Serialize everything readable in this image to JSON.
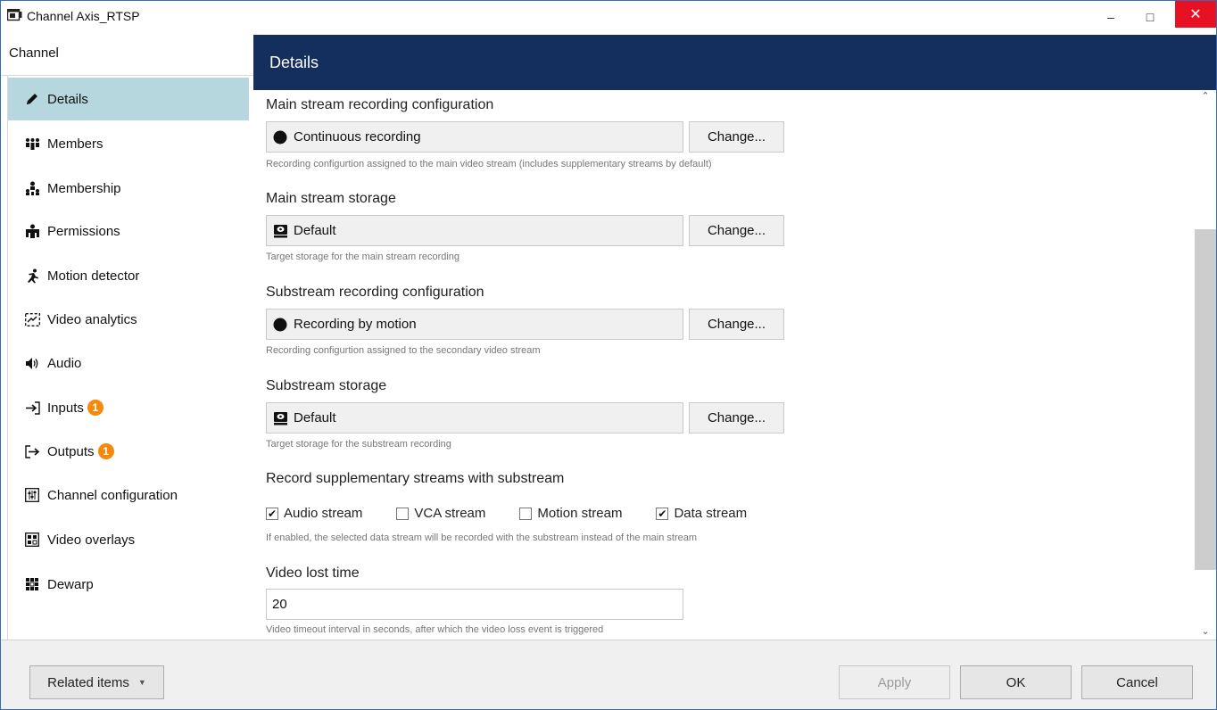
{
  "window": {
    "title": "Channel Axis_RTSP",
    "controls": {
      "minimize": "–",
      "maximize": "□",
      "close": "✕"
    }
  },
  "sidebar": {
    "header": "Channel",
    "items": [
      {
        "label": "Details",
        "icon": "pencil-icon",
        "active": true,
        "badge": null
      },
      {
        "label": "Members",
        "icon": "members-icon",
        "active": false,
        "badge": null
      },
      {
        "label": "Membership",
        "icon": "membership-icon",
        "active": false,
        "badge": null
      },
      {
        "label": "Permissions",
        "icon": "permissions-icon",
        "active": false,
        "badge": null
      },
      {
        "label": "Motion detector",
        "icon": "running-person-icon",
        "active": false,
        "badge": null
      },
      {
        "label": "Video analytics",
        "icon": "analytics-icon",
        "active": false,
        "badge": null
      },
      {
        "label": "Audio",
        "icon": "speaker-icon",
        "active": false,
        "badge": null
      },
      {
        "label": "Inputs",
        "icon": "input-arrow-icon",
        "active": false,
        "badge": "1"
      },
      {
        "label": "Outputs",
        "icon": "output-arrow-icon",
        "active": false,
        "badge": "1"
      },
      {
        "label": "Channel configuration",
        "icon": "config-icon",
        "active": false,
        "badge": null
      },
      {
        "label": "Video overlays",
        "icon": "overlay-icon",
        "active": false,
        "badge": null
      },
      {
        "label": "Dewarp",
        "icon": "dewarp-icon",
        "active": false,
        "badge": null
      }
    ]
  },
  "main": {
    "header": "Details",
    "main_recording": {
      "title": "Main stream recording configuration",
      "value": "Continuous recording",
      "button": "Change...",
      "hint": "Recording configurtion assigned to the main video stream (includes supplementary streams by default)"
    },
    "main_storage": {
      "title": "Main stream storage",
      "value": "Default",
      "button": "Change...",
      "hint": "Target storage for the main stream recording"
    },
    "sub_recording": {
      "title": "Substream recording configuration",
      "value": "Recording by motion",
      "button": "Change...",
      "hint": "Recording configurtion assigned to the secondary video stream"
    },
    "sub_storage": {
      "title": "Substream storage",
      "value": "Default",
      "button": "Change...",
      "hint": "Target storage for the substream recording"
    },
    "supplementary": {
      "title": "Record supplementary streams with substream",
      "options": [
        {
          "label": "Audio stream",
          "checked": true
        },
        {
          "label": "VCA stream",
          "checked": false
        },
        {
          "label": "Motion stream",
          "checked": false
        },
        {
          "label": "Data stream",
          "checked": true
        }
      ],
      "hint": "If enabled, the selected data stream will be recorded with the substream instead of the main stream"
    },
    "video_lost": {
      "title": "Video lost time",
      "value": "20",
      "hint": "Video timeout interval in seconds, after which the video loss event is triggered"
    }
  },
  "footer": {
    "related": "Related items",
    "apply": "Apply",
    "ok": "OK",
    "cancel": "Cancel"
  },
  "colors": {
    "header_bg": "#142f5e",
    "active_nav": "#b7d7de",
    "badge": "#f5890c",
    "close_btn": "#e81123"
  }
}
